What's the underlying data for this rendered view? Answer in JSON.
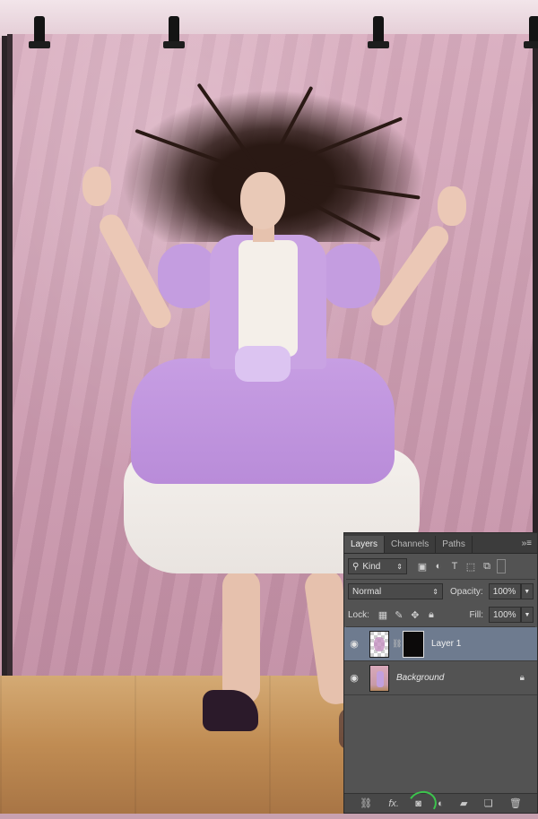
{
  "layers_panel": {
    "tabs": [
      {
        "label": "Layers",
        "active": true
      },
      {
        "label": "Channels",
        "active": false
      },
      {
        "label": "Paths",
        "active": false
      }
    ],
    "filter": {
      "selected": "Kind"
    },
    "blend_mode": "Normal",
    "opacity_label": "Opacity:",
    "opacity_value": "100%",
    "lock_label": "Lock:",
    "fill_label": "Fill:",
    "fill_value": "100%",
    "layers": [
      {
        "name": "Layer 1",
        "visible": true,
        "selected": true,
        "has_mask": true,
        "locked": false
      },
      {
        "name": "Background",
        "visible": true,
        "selected": false,
        "has_mask": false,
        "locked": true
      }
    ],
    "bottom_buttons": [
      "link-layers",
      "fx",
      "add-layer-mask",
      "adjustment-layer",
      "new-group",
      "new-layer",
      "delete-layer"
    ],
    "bottom_fx_label": "fx.",
    "highlight_color": "#3cc44d"
  },
  "canvas": {
    "subject": "photo",
    "backdrop_color": "#d2a6b7",
    "floor_color": "#c08c53"
  }
}
